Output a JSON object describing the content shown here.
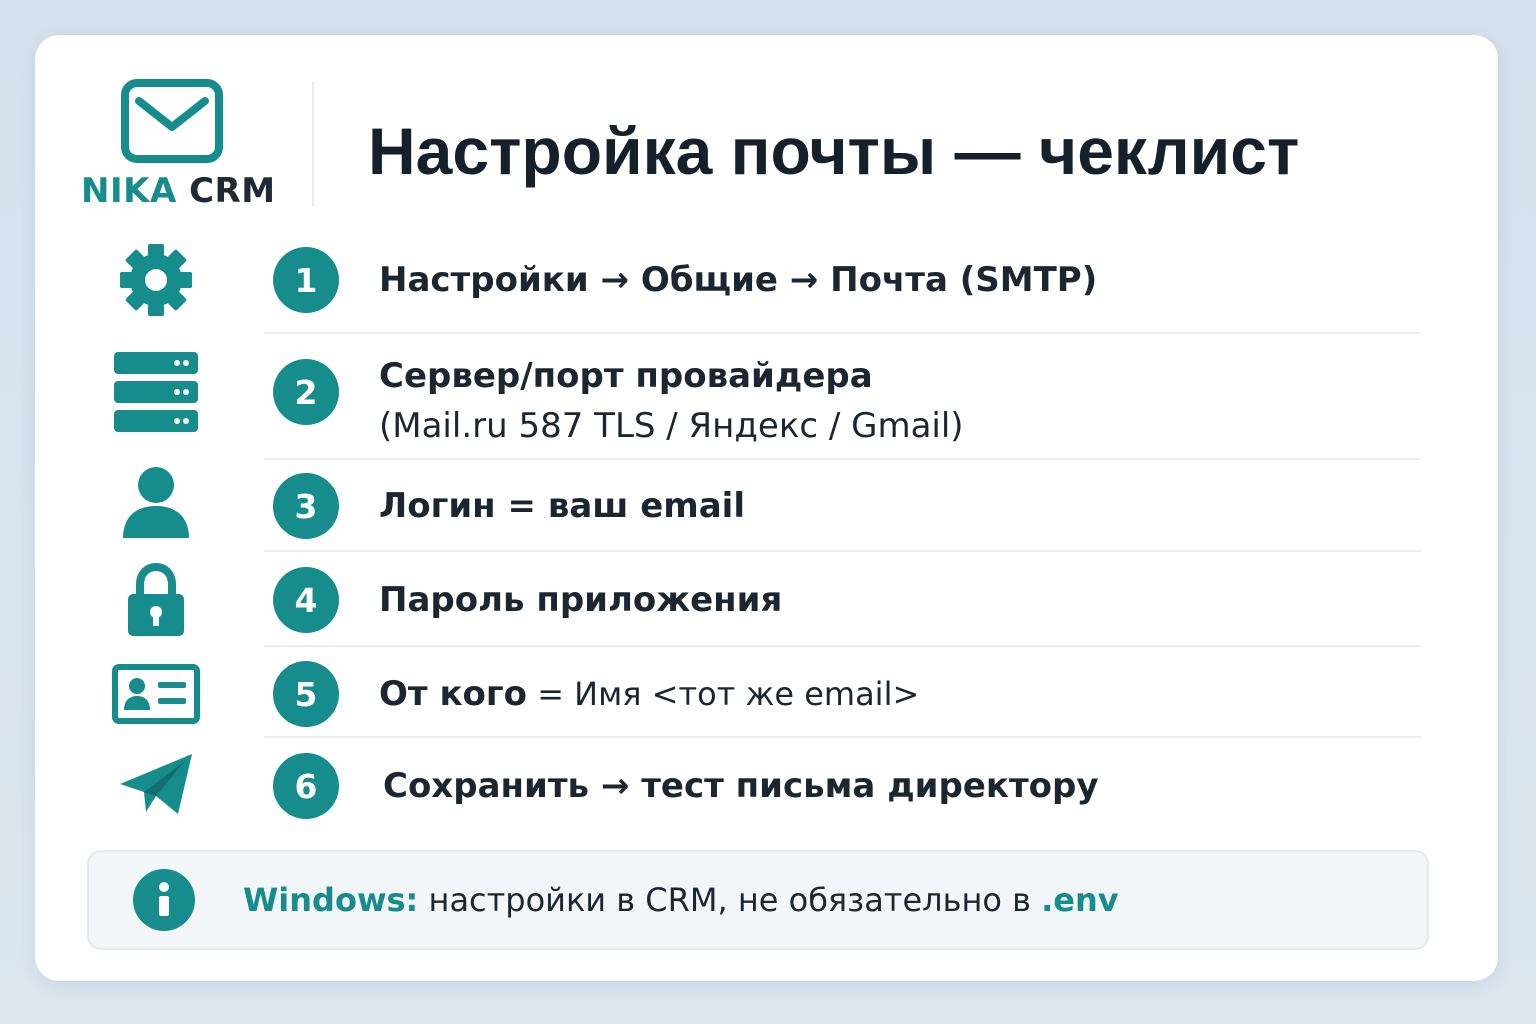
{
  "brand": {
    "name_accent": "NIKA",
    "name_rest": "CRM",
    "accent_color": "#168c8c"
  },
  "title": "Настройка почты — чеклист",
  "steps": [
    {
      "number": "1",
      "icon": "gear-icon",
      "text": "Настройки → Общие → Почта (SMTP)"
    },
    {
      "number": "2",
      "icon": "server-icon",
      "text": "Сервер/порт провайдера",
      "subtext": "(Mail.ru 587 TLS / Яндекс / Gmail)"
    },
    {
      "number": "3",
      "icon": "user-icon",
      "text": "Логин = ваш email"
    },
    {
      "number": "4",
      "icon": "lock-icon",
      "text": "Пароль приложения"
    },
    {
      "number": "5",
      "icon": "id-card-icon",
      "text_bold": "От кого",
      "text_rest": " = Имя <тот же email>"
    },
    {
      "number": "6",
      "icon": "paper-plane-icon",
      "text": "Сохранить → тест письма директору"
    }
  ],
  "info": {
    "icon": "info-icon",
    "label": "Windows:",
    "text": " настройки в CRM, не обязательно в ",
    "highlight": ".env"
  }
}
